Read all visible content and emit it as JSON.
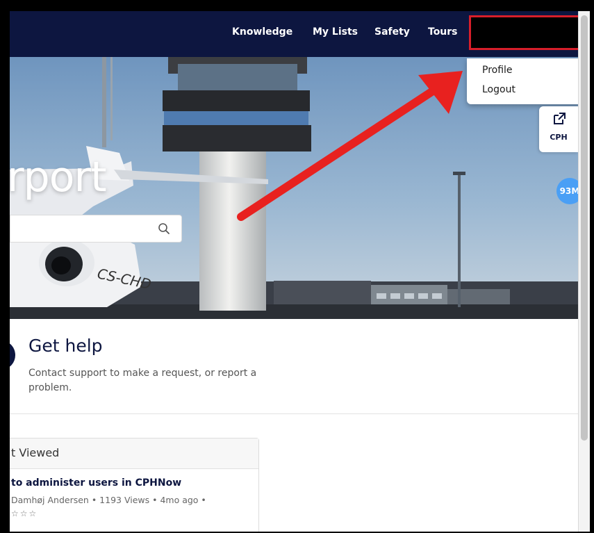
{
  "header": {
    "nav": [
      {
        "label": "Knowledge"
      },
      {
        "label": "My Lists"
      },
      {
        "label": "Safety"
      },
      {
        "label": "Tours"
      }
    ]
  },
  "user_menu": {
    "items": [
      {
        "label": "Profile"
      },
      {
        "label": "Logout"
      }
    ]
  },
  "hero": {
    "title_partial": "rport",
    "search_placeholder": "",
    "aircraft_registration": "CS-CHD"
  },
  "side_widget": {
    "label": "CPH",
    "icon": "external-link-icon"
  },
  "memory_badge": "93M",
  "get_help": {
    "title": "Get help",
    "description": "Contact support to make a request, or report a problem."
  },
  "most_viewed": {
    "title_partial": "t Viewed",
    "article_title": "to administer users in CPHNow",
    "article_meta": "Damhøj Andersen  •  1193 Views  •  4mo ago  •",
    "stars": "☆☆☆"
  },
  "colors": {
    "header_bg": "#0d1640",
    "annotation_red": "#d81e2a",
    "badge_blue": "#4a9ff5"
  }
}
